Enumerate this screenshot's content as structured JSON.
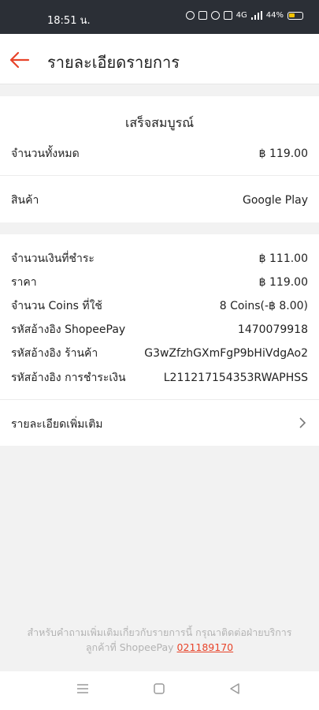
{
  "status_bar": {
    "time": "18:51 น.",
    "battery_pct": "44%",
    "battery_level": 0.44,
    "network": "4G"
  },
  "header": {
    "title": "รายละเอียดรายการ",
    "accent_color": "#e8442a"
  },
  "summary": {
    "status": "เสร็จสมบูรณ์",
    "total_label": "จำนวนทั้งหมด",
    "total_value": "฿ 119.00",
    "product_label": "สินค้า",
    "product_value": "Google Play"
  },
  "details": [
    {
      "label": "จำนวนเงินที่ชำระ",
      "value": "฿ 111.00"
    },
    {
      "label": "ราคา",
      "value": "฿ 119.00"
    },
    {
      "label": "จำนวน Coins ที่ใช้",
      "value": "8 Coins(-฿ 8.00)"
    },
    {
      "label": "รหัสอ้างอิง ShopeePay",
      "value": "1470079918"
    },
    {
      "label": "รหัสอ้างอิง ร้านค้า",
      "value": "G3wZfzhGXmFgP9bHiVdgAo2"
    },
    {
      "label": "รหัสอ้างอิง การชำระเงิน",
      "value": "L211217154353RWAPHSS"
    }
  ],
  "more": {
    "label": "รายละเอียดเพิ่มเติม"
  },
  "footer": {
    "line1": "สำหรับคำถามเพิ่มเติมเกี่ยวกับรายการนี้ กรุณาติดต่อฝ่ายบริการ",
    "line2_prefix": "ลูกค้าที่ ShopeePay",
    "phone": "021189170"
  },
  "navbar": {
    "icons": [
      "menu-icon",
      "home-square-icon",
      "back-triangle-icon"
    ]
  }
}
